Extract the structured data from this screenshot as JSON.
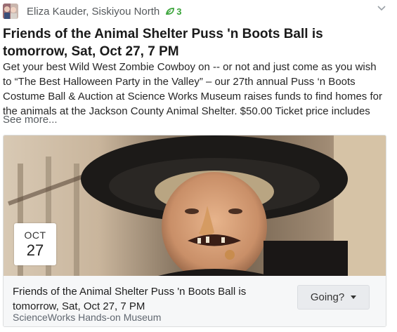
{
  "post": {
    "author": "Eliza Kauder, Siskiyou North",
    "thanks_count": "3",
    "title": "Friends of the Animal Shelter Puss 'n Boots Ball is tomorrow, Sat, Oct 27, 7 PM",
    "body_line1": "Get your best Wild West Zombie Cowboy on -- or not and just come as you wish",
    "body_line2": "to “The Best Halloween Party in the Valley” – our 27th annual Puss ‘n Boots",
    "body_line3": "Costume Ball & Auction at Science Works Museum raises funds to find homes for",
    "body_line4": "the animals at the Jackson County Animal Shelter. $50.00 Ticket price includes",
    "see_more": "See more..."
  },
  "event": {
    "month": "OCT",
    "day": "27",
    "title": "Friends of the Animal Shelter Puss 'n Boots Ball is tomorrow, Sat, Oct 27, 7 PM",
    "place": "ScienceWorks Hands-on Museum",
    "rsvp_label": "Going?"
  },
  "icons": {
    "avatar": "user-avatar",
    "thanks": "leaf-icon",
    "menu": "chevron-down-icon",
    "rsvp_caret": "caret-down-icon"
  },
  "colors": {
    "thanks_green": "#3aa43a",
    "footer_bg": "#f6f7f8",
    "button_bg": "#e9ebee"
  }
}
